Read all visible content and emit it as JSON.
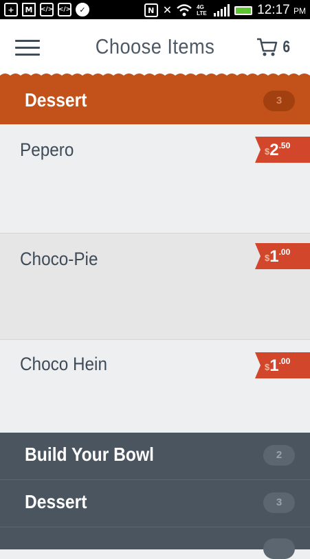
{
  "status_bar": {
    "time": "12:17",
    "ampm": "PM",
    "network": "4G LTE",
    "icons": [
      "add-icon",
      "gmail-icon",
      "code-icon",
      "code-icon",
      "check-icon",
      "nfc-icon",
      "mute-icon",
      "wifi-icon",
      "signal-icon",
      "battery-icon"
    ]
  },
  "app_bar": {
    "title": "Choose Items",
    "cart_count": "6"
  },
  "active_category": {
    "name": "Dessert",
    "count": "3"
  },
  "items": [
    {
      "name": "Pepero",
      "currency": "$",
      "price_int": "2",
      "price_dec": ".50"
    },
    {
      "name": "Choco-Pie",
      "currency": "$",
      "price_int": "1",
      "price_dec": ".00"
    },
    {
      "name": "Choco Hein",
      "currency": "$",
      "price_int": "1",
      "price_dec": ".00"
    }
  ],
  "categories": [
    {
      "name": "Build Your Bowl",
      "count": "2"
    },
    {
      "name": "Dessert",
      "count": "3"
    }
  ],
  "colors": {
    "active_category_bg": "#c2521a",
    "price_tag": "#d2472c",
    "category_bg": "#4b5560",
    "text_dark": "#3f4b57"
  }
}
